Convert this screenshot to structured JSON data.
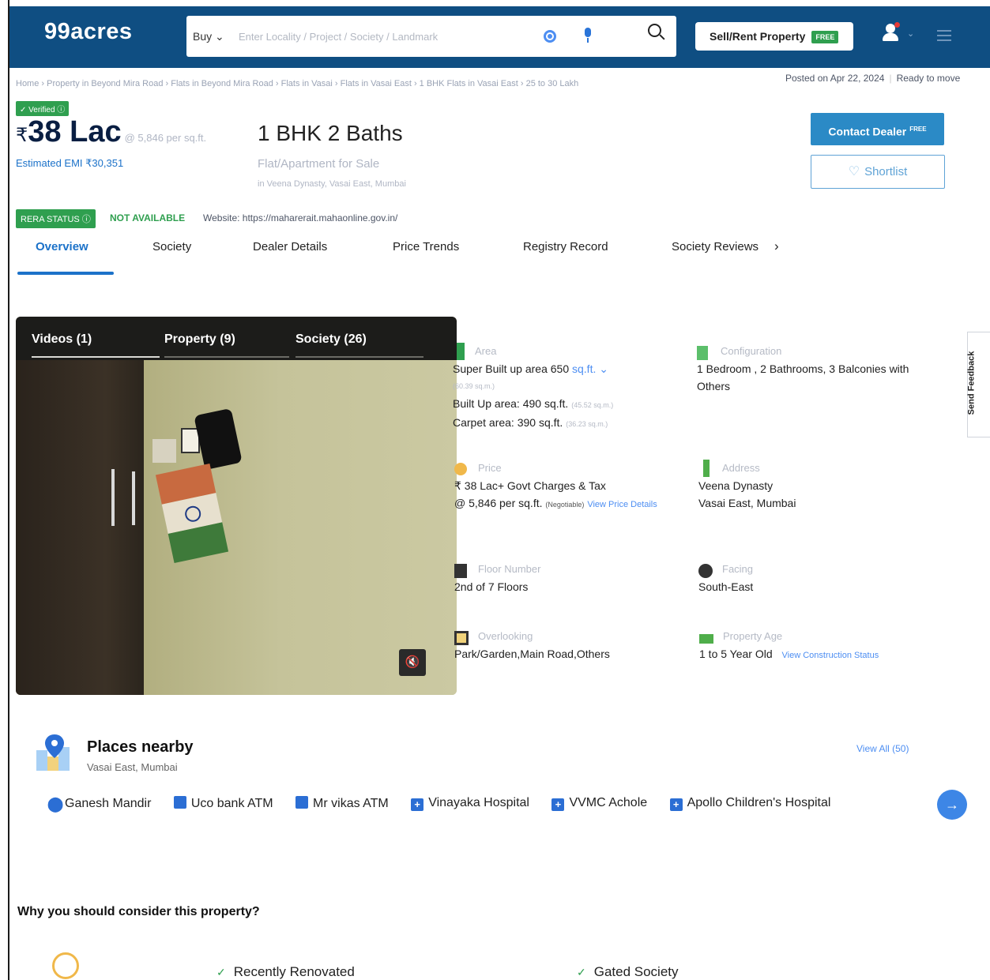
{
  "header": {
    "logo": "99acres",
    "buy_label": "Buy",
    "search_placeholder": "Enter Locality / Project / Society / Landmark",
    "sell_label": "Sell/Rent Property",
    "free_tag": "FREE"
  },
  "breadcrumb": "Home › Property in Beyond Mira Road › Flats in Beyond Mira Road › Flats in Vasai › Flats in Vasai East › 1 BHK Flats in Vasai East › 25 to 30 Lakh",
  "posted": {
    "date": "Posted on Apr 22, 2024",
    "status": "Ready to move"
  },
  "summary": {
    "verified": "✓ Verified",
    "rupee": "₹",
    "price": "38 Lac",
    "price_per_sqft": "@ 5,846 per sq.ft.",
    "emi": "Estimated EMI ₹30,351",
    "title": "1 BHK 2 Baths",
    "subtitle": "Flat/Apartment for Sale",
    "location_line": "in Veena Dynasty, Vasai East, Mumbai",
    "contact_label": "Contact Dealer",
    "contact_sup": "FREE",
    "shortlist_label": "Shortlist"
  },
  "rera": {
    "label": "RERA STATUS",
    "value": "NOT AVAILABLE",
    "website": "Website: https://maharerait.mahaonline.gov.in/"
  },
  "tabs": [
    "Overview",
    "Society",
    "Dealer Details",
    "Price Trends",
    "Registry Record",
    "Society Reviews"
  ],
  "gallery": {
    "tabs": [
      "Videos (1)",
      "Property (9)",
      "Society (26)"
    ],
    "active_tab": 0
  },
  "details": {
    "area": {
      "label": "Area",
      "super_built": "Super Built up area 650",
      "unit": "sq.ft.",
      "super_sqm": "(60.39 sq.m.)",
      "built_up": "Built Up area: 490 sq.ft.",
      "built_sqm": "(45.52 sq.m.)",
      "carpet": "Carpet area: 390 sq.ft.",
      "carpet_sqm": "(36.23 sq.m.)"
    },
    "configuration": {
      "label": "Configuration",
      "value": "1 Bedroom , 2 Bathrooms, 3 Balconies with Others"
    },
    "price": {
      "label": "Price",
      "line1": "₹ 38 Lac+ Govt Charges & Tax",
      "line2": "@ 5,846 per sq.ft.",
      "negotiable": "(Negotiable)",
      "link": "View Price Details"
    },
    "address": {
      "label": "Address",
      "line1": "Veena Dynasty",
      "line2": "Vasai East, Mumbai"
    },
    "floor": {
      "label": "Floor Number",
      "value": "2nd of 7 Floors"
    },
    "facing": {
      "label": "Facing",
      "value": "South-East"
    },
    "overlooking": {
      "label": "Overlooking",
      "value": "Park/Garden,Main Road,Others"
    },
    "age": {
      "label": "Property Age",
      "value": "1 to 5 Year Old",
      "link": "View Construction Status"
    }
  },
  "feedback": "Send Feedback",
  "places": {
    "title": "Places nearby",
    "subtitle": "Vasai East, Mumbai",
    "view_all": "View All (50)",
    "items": [
      "Ganesh Mandir",
      "Uco bank ATM",
      "Mr vikas ATM",
      "Vinayaka Hospital",
      "VVMC Achole",
      "Apollo Children's Hospital"
    ]
  },
  "why": {
    "title": "Why you should consider this property?",
    "items": [
      "Recently Renovated",
      "Gated Society"
    ]
  },
  "colors": {
    "header": "#0f4e82",
    "accent": "#1c72c9",
    "green": "#2f9f4f",
    "button": "#2b8ac6"
  }
}
